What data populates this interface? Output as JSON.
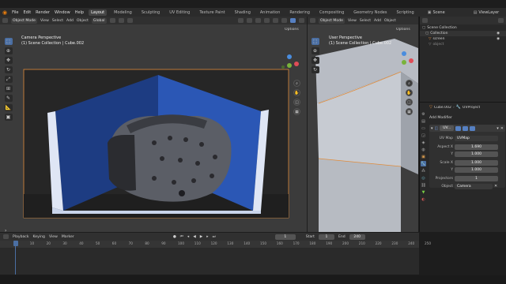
{
  "menu": [
    "File",
    "Edit",
    "Render",
    "Window",
    "Help"
  ],
  "workspaces": [
    "Layout",
    "Modeling",
    "Sculpting",
    "UV Editing",
    "Texture Paint",
    "Shading",
    "Animation",
    "Rendering",
    "Compositing",
    "Geometry Nodes",
    "Scripting"
  ],
  "active_workspace": "Layout",
  "scene_name": "Scene",
  "view_layer": "ViewLayer",
  "viewport1": {
    "mode": "Object Mode",
    "menus": [
      "View",
      "Select",
      "Add",
      "Object"
    ],
    "transform": "Global",
    "title": "Camera Perspective",
    "subtitle": "(1) Scene Collection | Cube.002",
    "options": "Options"
  },
  "viewport2": {
    "mode": "Object Mode",
    "menus": [
      "View",
      "Select",
      "Add",
      "Object"
    ],
    "title": "User Perspective",
    "subtitle": "(1) Scene Collection | Cube.002",
    "options": "Options"
  },
  "outliner": {
    "items": [
      {
        "label": "Scene Collection"
      },
      {
        "label": "Collection"
      },
      {
        "label": "screen"
      },
      {
        "label": "object"
      }
    ]
  },
  "properties": {
    "object_name": "Cube.002",
    "modifier_name": "UVProject",
    "add_modifier": "Add Modifier",
    "modifier_short": "UV...",
    "uv_map_label": "UV Map",
    "uv_map_value": "UVMap",
    "aspect_x_label": "Aspect X",
    "aspect_x": "1.690",
    "aspect_y_label": "Y",
    "aspect_y": "1.000",
    "scale_x_label": "Scale X",
    "scale_x": "1.000",
    "scale_y_label": "Y",
    "scale_y": "1.000",
    "projectors_label": "Projectors",
    "projectors": "1",
    "object_label": "Object",
    "object_value": "Camera"
  },
  "timeline": {
    "menus": [
      "Playback",
      "Keying",
      "View",
      "Marker"
    ],
    "current_frame": "1",
    "start_label": "Start",
    "start": "1",
    "end_label": "End",
    "end": "240",
    "ruler": [
      "1",
      "10",
      "20",
      "30",
      "40",
      "50",
      "60",
      "70",
      "80",
      "90",
      "100",
      "110",
      "120",
      "130",
      "140",
      "150",
      "160",
      "170",
      "180",
      "190",
      "200",
      "210",
      "220",
      "230",
      "240",
      "250"
    ]
  },
  "colors": {
    "accent": "#4b6fa3",
    "blue_wall": "#2e4f9a",
    "camera_frame": "#e08c3c"
  }
}
